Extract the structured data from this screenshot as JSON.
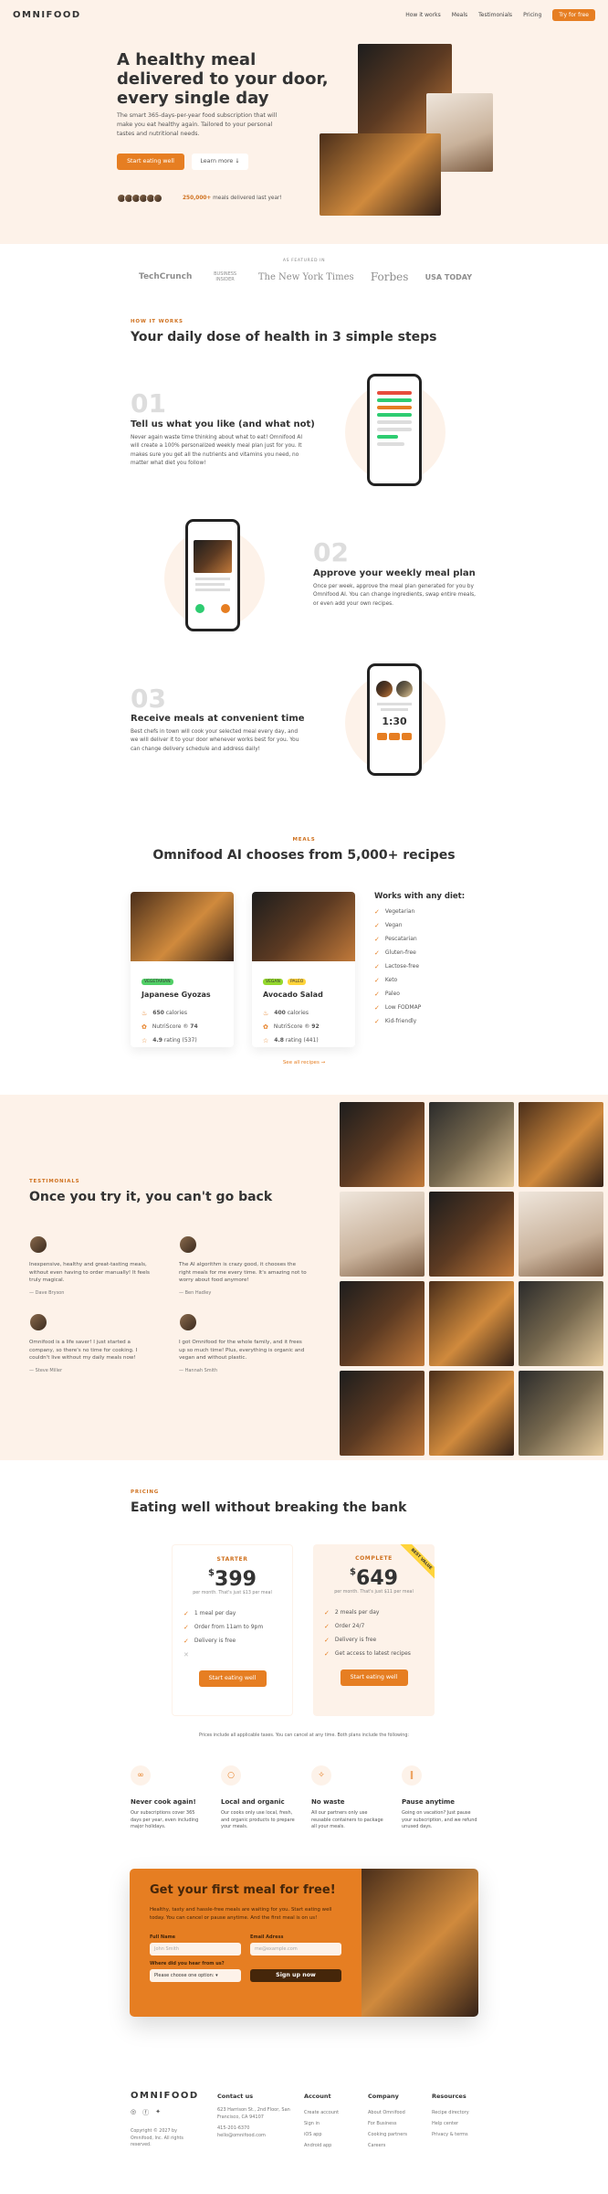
{
  "header": {
    "logo": "OMNIFOOD",
    "nav": [
      "How it works",
      "Meals",
      "Testimonials",
      "Pricing"
    ],
    "cta": "Try for free"
  },
  "hero": {
    "title": "A healthy meal delivered to your door, every single day",
    "text": "The smart 365-days-per-year food subscription that will make you eat healthy again. Tailored to your personal tastes and nutritional needs.",
    "btn_primary": "Start eating well",
    "btn_secondary": "Learn more ↓",
    "delivered_count": "250,000+",
    "delivered_text": "meals delivered last year!"
  },
  "featured": {
    "label": "AS FEATURED IN",
    "logos": [
      "TechCrunch",
      "BUSINESS INSIDER",
      "The New York Times",
      "Forbes",
      "USA TODAY"
    ]
  },
  "how": {
    "subheading": "HOW IT WORKS",
    "heading": "Your daily dose of health in 3 simple steps",
    "steps": [
      {
        "num": "01",
        "title": "Tell us what you like (and what not)",
        "text": "Never again waste time thinking about what to eat! Omnifood AI will create a 100% personalized weekly meal plan just for you. It makes sure you get all the nutrients and vitamins you need, no matter what diet you follow!"
      },
      {
        "num": "02",
        "title": "Approve your weekly meal plan",
        "text": "Once per week, approve the meal plan generated for you by Omnifood AI. You can change ingredients, swap entire meals, or even add your own recipes."
      },
      {
        "num": "03",
        "title": "Receive meals at convenient time",
        "text": "Best chefs in town will cook your selected meal every day, and we will deliver it to your door whenever works best for you. You can change delivery schedule and address daily!"
      }
    ],
    "phone_timer": "1:30"
  },
  "meals": {
    "subheading": "MEALS",
    "heading": "Omnifood AI chooses from 5,000+ recipes",
    "cards": [
      {
        "tags": [
          "VEGETARIAN"
        ],
        "title": "Japanese Gyozas",
        "calories": "650",
        "calories_label": "calories",
        "nutri": "74",
        "nutri_label": "NutriScore ®",
        "rating": "4.9",
        "rating_text": "rating (537)"
      },
      {
        "tags": [
          "VEGAN",
          "PALEO"
        ],
        "title": "Avocado Salad",
        "calories": "400",
        "calories_label": "calories",
        "nutri": "92",
        "nutri_label": "NutriScore ®",
        "rating": "4.8",
        "rating_text": "rating (441)"
      }
    ],
    "diet_title": "Works with any diet:",
    "diets": [
      "Vegetarian",
      "Vegan",
      "Pescatarian",
      "Gluten-free",
      "Lactose-free",
      "Keto",
      "Paleo",
      "Low FODMAP",
      "Kid-friendly"
    ],
    "all_recipes": "See all recipes →"
  },
  "testimonials": {
    "subheading": "TESTIMONIALS",
    "heading": "Once you try it, you can't go back",
    "items": [
      {
        "text": "Inexpensive, healthy and great-tasting meals, without even having to order manually! It feels truly magical.",
        "name": "— Dave Bryson"
      },
      {
        "text": "The AI algorithm is crazy good, it chooses the right meals for me every time. It's amazing not to worry about food anymore!",
        "name": "— Ben Hadley"
      },
      {
        "text": "Omnifood is a life saver! I just started a company, so there's no time for cooking. I couldn't live without my daily meals now!",
        "name": "— Steve Miller"
      },
      {
        "text": "I got Omnifood for the whole family, and it frees up so much time! Plus, everything is organic and vegan and without plastic.",
        "name": "— Hannah Smith"
      }
    ]
  },
  "pricing": {
    "subheading": "PRICING",
    "heading": "Eating well without breaking the bank",
    "plans": [
      {
        "name": "STARTER",
        "price": "399",
        "currency": "$",
        "per": "per month. That's just $13 per meal",
        "features": [
          "1 meal per day",
          "Order from 11am to 9pm",
          "Delivery is free",
          ""
        ],
        "cta": "Start eating well"
      },
      {
        "name": "COMPLETE",
        "price": "649",
        "currency": "$",
        "per": "per month. That's just $11 per meal",
        "features": [
          "2 meals per day",
          "Order 24/7",
          "Delivery is free",
          "Get access to latest recipes"
        ],
        "cta": "Start eating well",
        "ribbon": "BEST VALUE"
      }
    ],
    "note": "Prices include all applicable taxes. You can cancel at any time. Both plans include the following:",
    "features": [
      {
        "icon": "∞",
        "title": "Never cook again!",
        "text": "Our subscriptions cover 365 days per year, even including major holidays."
      },
      {
        "icon": "○",
        "title": "Local and organic",
        "text": "Our cooks only use local, fresh, and organic products to prepare your meals."
      },
      {
        "icon": "✧",
        "title": "No waste",
        "text": "All our partners only use reusable containers to package all your meals."
      },
      {
        "icon": "‖",
        "title": "Pause anytime",
        "text": "Going on vacation? Just pause your subscription, and we refund unused days."
      }
    ]
  },
  "cta": {
    "heading": "Get your first meal for free!",
    "text": "Healthy, tasty and hassle-free meals are waiting for you. Start eating well today. You can cancel or pause anytime. And the first meal is on us!",
    "full_name_label": "Full Name",
    "full_name_ph": "John Smith",
    "email_label": "Email Adress",
    "email_ph": "me@example.com",
    "where_label": "Where did you hear from us?",
    "select_value": "Please choose one option:",
    "submit": "Sign up now"
  },
  "footer": {
    "logo": "OMNIFOOD",
    "copyright": "Copyright © 2027 by Omnifood, Inc. All rights reserved.",
    "contact_title": "Contact us",
    "address": "623 Harrison St., 2nd Floor, San Francisco, CA 94107",
    "phone": "415-201-6370",
    "email": "hello@omnifood.com",
    "account_title": "Account",
    "account": [
      "Create account",
      "Sign in",
      "iOS app",
      "Android app"
    ],
    "company_title": "Company",
    "company": [
      "About Omnifood",
      "For Business",
      "Cooking partners",
      "Careers"
    ],
    "resources_title": "Resources",
    "resources": [
      "Recipe directory",
      "Help center",
      "Privacy & terms"
    ]
  },
  "colors": {
    "primary": "#e67e22",
    "tint": "#fdf2e9",
    "shade": "#cf711f",
    "text": "#333333"
  }
}
